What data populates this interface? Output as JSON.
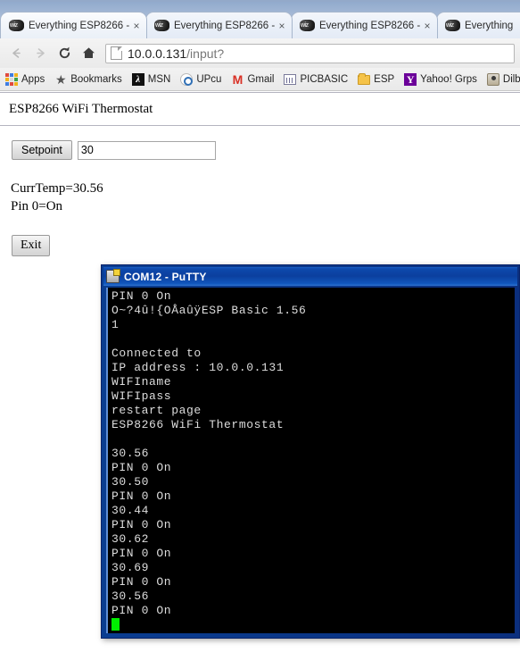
{
  "browser": {
    "tabs": [
      {
        "title": "Everything ESP8266 -",
        "favicon": "wiz-favicon",
        "close": "×",
        "active": true
      },
      {
        "title": "Everything ESP8266 -",
        "favicon": "wiz-favicon",
        "close": "×",
        "active": false
      },
      {
        "title": "Everything ESP8266 -",
        "favicon": "wiz-favicon",
        "close": "×",
        "active": false
      },
      {
        "title": "Everything",
        "favicon": "wiz-favicon",
        "close": "",
        "active": false
      }
    ],
    "nav": {
      "back_icon": "←",
      "forward_icon": "→",
      "reload_icon": "⟳",
      "home_icon": "home-icon"
    },
    "address": {
      "value": "10.0.0.131/input?",
      "host": "10.0.0.131",
      "path": "/input?",
      "page_icon": "page-icon"
    },
    "bookmarks": [
      {
        "label": "Apps",
        "icon": "apps-grid-icon"
      },
      {
        "label": "Bookmarks",
        "icon": "star-icon"
      },
      {
        "label": "MSN",
        "icon": "msn-icon"
      },
      {
        "label": "UPcu",
        "icon": "upcu-icon"
      },
      {
        "label": "Gmail",
        "icon": "gmail-icon"
      },
      {
        "label": "PICBASIC",
        "icon": "picbasic-icon"
      },
      {
        "label": "ESP",
        "icon": "folder-icon"
      },
      {
        "label": "Yahoo! Grps",
        "icon": "yahoo-icon"
      },
      {
        "label": "Dilbe",
        "icon": "dilbert-icon"
      }
    ]
  },
  "page": {
    "heading": "ESP8266 WiFi Thermostat",
    "setpoint_button": "Setpoint",
    "setpoint_value": "30",
    "setpoint_placeholder": "",
    "status_lines": [
      "CurrTemp=30.56",
      "Pin 0=On"
    ],
    "exit_button": "Exit"
  },
  "putty": {
    "title": "COM12 - PuTTY",
    "icon": "putty-window-icon",
    "terminal_lines": [
      "PIN 0 On",
      "O~?4û!{OÅaûÿESP Basic 1.56",
      "1",
      "",
      "Connected to",
      "IP address : 10.0.0.131",
      "WIFIname",
      "WIFIpass",
      "restart page",
      "ESP8266 WiFi Thermostat",
      "",
      "30.56",
      "PIN 0 On",
      "30.50",
      "PIN 0 On",
      "30.44",
      "PIN 0 On",
      "30.62",
      "PIN 0 On",
      "30.69",
      "PIN 0 On",
      "30.56",
      "PIN 0 On"
    ],
    "cursor": "block-cursor",
    "colors": {
      "background": "#000000",
      "text": "#dcdcdc",
      "cursor": "#00ee00",
      "title_bar": "#0b3f9e"
    }
  }
}
